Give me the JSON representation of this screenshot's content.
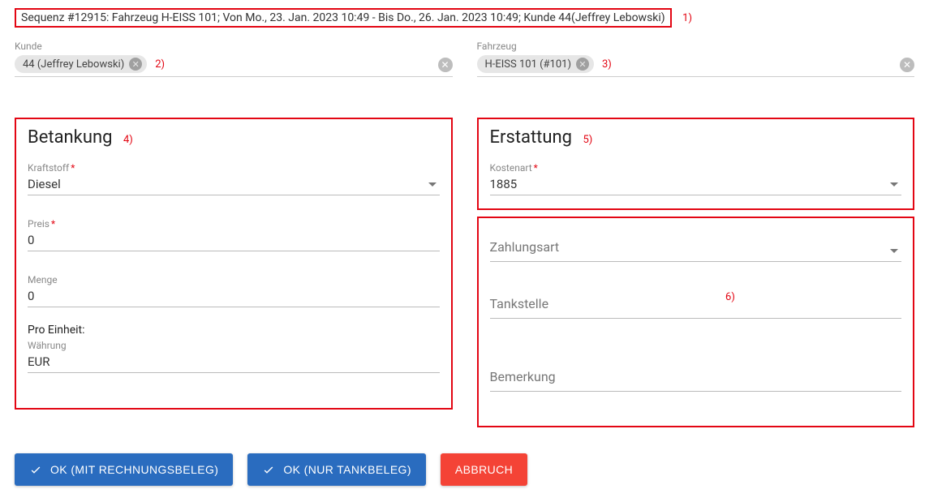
{
  "header": {
    "title": "Sequenz #12915: Fahrzeug H-EISS 101; Von Mo., 23. Jan. 2023 10:49 - Bis Do., 26. Jan. 2023 10:49; Kunde 44(Jeffrey Lebowski)"
  },
  "annotations": {
    "a1": "1)",
    "a2": "2)",
    "a3": "3)",
    "a4": "4)",
    "a5": "5)",
    "a6": "6)"
  },
  "kunde": {
    "label": "Kunde",
    "chip": "44 (Jeffrey Lebowski)"
  },
  "fahrzeug": {
    "label": "Fahrzeug",
    "chip": "H-EISS 101 (#101)"
  },
  "betankung": {
    "title": "Betankung",
    "kraftstoff": {
      "label": "Kraftstoff",
      "value": "Diesel",
      "required": true
    },
    "preis": {
      "label": "Preis",
      "value": "0",
      "required": true
    },
    "menge": {
      "label": "Menge",
      "value": "0",
      "required": false
    },
    "pro_einheit_label": "Pro Einheit:",
    "waehrung": {
      "label": "Währung",
      "value": "EUR",
      "required": false
    }
  },
  "erstattung": {
    "title": "Erstattung",
    "kostenart": {
      "label": "Kostenart",
      "value": "1885",
      "required": true
    }
  },
  "extras": {
    "zahlungsart": {
      "placeholder": "Zahlungsart"
    },
    "tankstelle": {
      "placeholder": "Tankstelle"
    },
    "bemerkung": {
      "placeholder": "Bemerkung"
    }
  },
  "buttons": {
    "ok_rechnung": "OK (MIT RECHNUNGSBELEG)",
    "ok_tank": "OK (NUR TANKBELEG)",
    "abbruch": "ABBRUCH"
  }
}
